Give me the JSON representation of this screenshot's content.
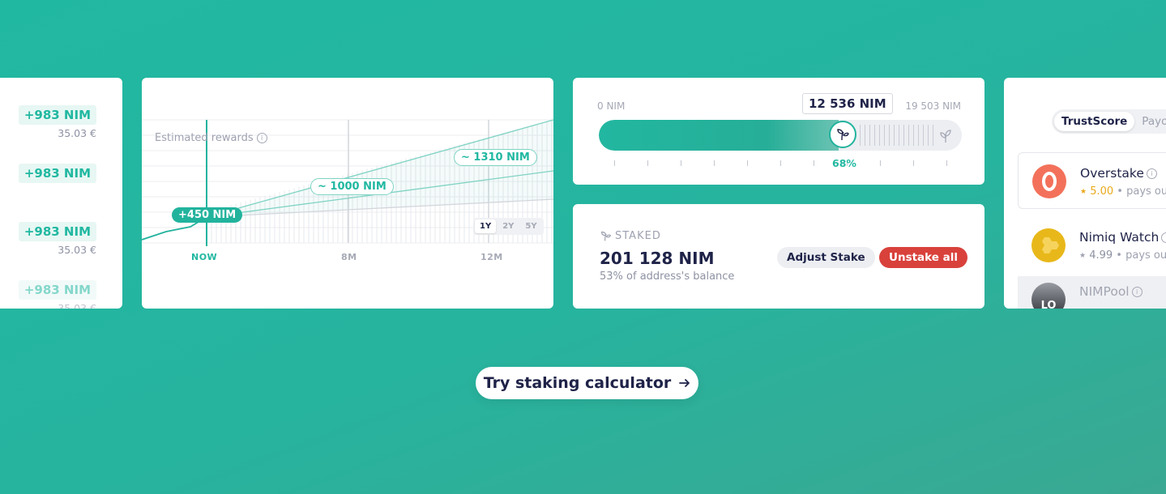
{
  "rewards_list": [
    {
      "amount": "+983 NIM",
      "fiat": "35.03 €"
    },
    {
      "amount": "+983 NIM",
      "fiat": ""
    },
    {
      "amount": "+983 NIM",
      "fiat": "35.03 €"
    },
    {
      "amount": "+983 NIM",
      "fiat": "35.03 €"
    }
  ],
  "chart": {
    "estimated_label": "Estimated rewards",
    "info_icon": "info-icon",
    "badges": {
      "now": "+450 NIM",
      "mid": "~ 1000 NIM",
      "end": "~ 1310 NIM"
    },
    "ranges": [
      "1Y",
      "2Y",
      "5Y"
    ],
    "active_range": "1Y"
  },
  "chart_data": {
    "type": "line",
    "title": "Estimated rewards",
    "x_ticks": [
      "NOW",
      "8M",
      "12M"
    ],
    "series": [],
    "annotations": [
      "+450 NIM",
      "~ 1000 NIM",
      "~ 1310 NIM"
    ],
    "grid": true
  },
  "slider": {
    "min_label": "0 NIM",
    "max_label": "19 503 NIM",
    "value_label": "12 536 NIM",
    "percent_label": "68%",
    "fill_fraction": 0.68,
    "handle_icon": "leaf-icon",
    "end_icon": "plant-icon"
  },
  "staked": {
    "label": "STAKED",
    "amount": "201 128 NIM",
    "subtitle": "53% of address's balance",
    "adjust_label": "Adjust Stake",
    "unstake_label": "Unstake all"
  },
  "validators": {
    "tabs": [
      "TrustScore",
      "Payout"
    ],
    "items": [
      {
        "name": "Overstake",
        "score": "5.00",
        "meta": "pays out",
        "logo_color": "#f3715a",
        "logo_icon": "overstake-logo-icon"
      },
      {
        "name": "Nimiq Watch",
        "score": "4.99",
        "meta": "pays out",
        "logo_color": "#e8b81a",
        "logo_icon": "nimiq-watch-logo-icon"
      },
      {
        "name": "NIMPool",
        "score": "",
        "meta": "",
        "logo_color": "#3a3d45",
        "logo_icon": "nimpool-logo-icon"
      }
    ]
  },
  "cta": {
    "label": "Try staking calculator",
    "arrow_icon": "arrow-right-icon"
  },
  "colors": {
    "background": "#21b8a1",
    "accent": "#21b8a1",
    "danger": "#d9413b",
    "gold": "#e9a91a",
    "text": "#1f2348"
  }
}
